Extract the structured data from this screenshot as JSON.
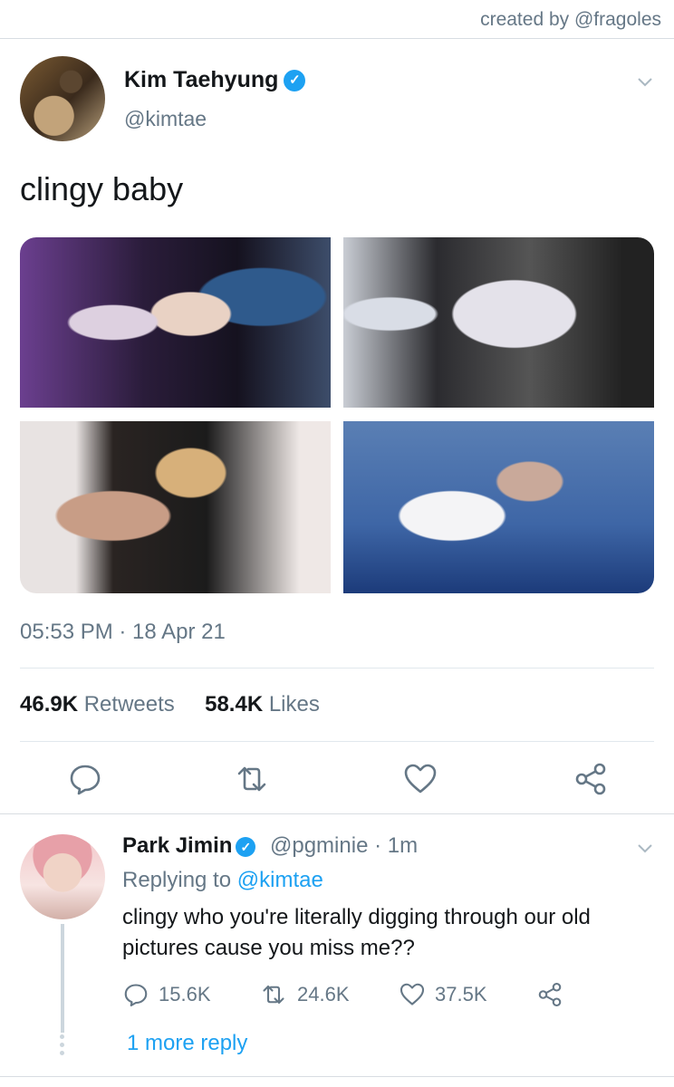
{
  "credit": "created by @fragoles",
  "tweet": {
    "author_name": "Kim Taehyung",
    "author_handle": "@kimtae",
    "verified": true,
    "text": "clingy baby",
    "timestamp": "05:53 PM · 18 Apr 21",
    "retweets_count": "46.9K",
    "retweets_label": "Retweets",
    "likes_count": "58.4K",
    "likes_label": "Likes",
    "actions": [
      "comment-icon",
      "retweet-icon",
      "heart-icon",
      "share-icon"
    ]
  },
  "reply": {
    "author_name": "Park Jimin",
    "author_handle": "@pgminie",
    "time": "· 1m",
    "verified": true,
    "replying_prefix": "Replying to",
    "replying_to": "@kimtae",
    "text": "clingy who you're literally digging through our old pictures cause you miss me??",
    "reply_count": "15.6K",
    "retweet_count": "24.6K",
    "like_count": "37.5K",
    "more_replies": "1 more reply"
  },
  "colors": {
    "accent": "#1da1f2",
    "secondary_text": "#657786",
    "divider": "#e1e8ed"
  }
}
